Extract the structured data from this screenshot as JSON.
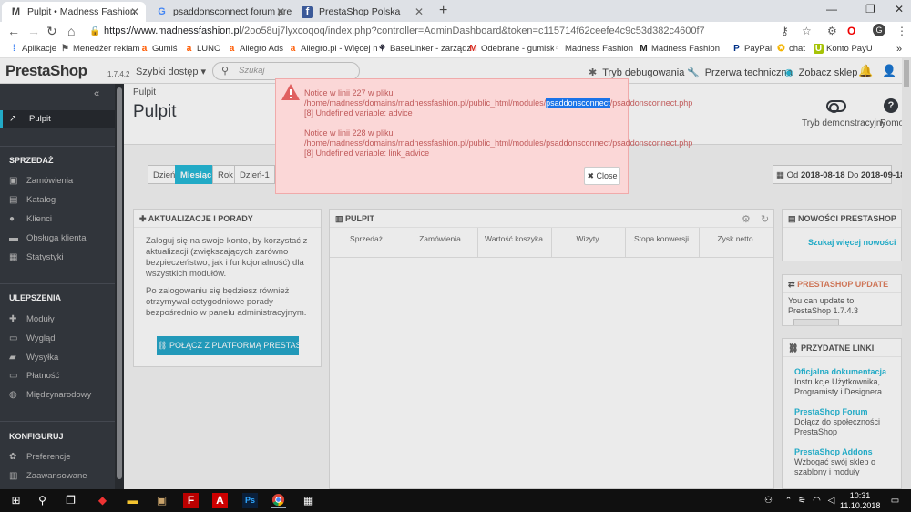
{
  "browser": {
    "tabs": [
      {
        "label": "Pulpit • Madness Fashion",
        "icon": "M"
      },
      {
        "label": "psaddonsconnect forum prestas",
        "icon": "G"
      },
      {
        "label": "PrestaShop Polska",
        "icon": "f"
      }
    ],
    "url_host": "https://www.madnessfashion.pl",
    "url_rest": "/2oo58uj7lyxcoqoq/index.php?controller=AdminDashboard&token=c115714f62ceefe4c9c53d382c4600f7",
    "profile": "G",
    "bookmarks": [
      "Aplikacje",
      "Menedżer reklam",
      "Gumiś",
      "LUNO",
      "Allegro Ads",
      "Allegro.pl - Więcej n",
      "BaseLinker - zarządz",
      "Odebrane - gumiskle",
      "Madness Fashion",
      "Madness Fashion (Pr",
      "PayPal",
      "chat",
      "Konto PayU"
    ]
  },
  "header": {
    "logo": "PrestaShop",
    "version": "1.7.4.2",
    "quick": "Szybki dostęp ▾",
    "search_placeholder": "Szukaj",
    "debug": "Tryb debugowania",
    "maintenance": "Przerwa techniczna",
    "view_shop": "Zobacz sklep"
  },
  "sidebar": {
    "active": "Pulpit",
    "sections": [
      "SPRZEDAŻ",
      "ULEPSZENIA",
      "KONFIGURUJ"
    ],
    "sales": [
      "Zamówienia",
      "Katalog",
      "Klienci",
      "Obsługa klienta",
      "Statystyki"
    ],
    "improve": [
      "Moduły",
      "Wygląd",
      "Wysyłka",
      "Płatność",
      "Międzynarodowy"
    ],
    "config": [
      "Preferencje",
      "Zaawansowane"
    ]
  },
  "page": {
    "breadcrumb": "Pulpit",
    "title": "Pulpit",
    "demo": "Tryb demonstracyjny",
    "help": "Pomoc"
  },
  "datebar": {
    "buttons": [
      "Dzień",
      "Miesiąc",
      "Rok",
      "Dzień-1"
    ],
    "active": "Miesiąc",
    "range_from": "2018-08-18",
    "range_to": "2018-09-18",
    "prefix": "Od",
    "mid": "Do"
  },
  "panels": {
    "updates": {
      "title": "AKTUALIZACJE I PORADY",
      "text1": "Zaloguj się na swoje konto, by korzystać z aktualizacji (zwiększających zarówno bezpieczeństwo, jak i funkcjonalność) dla wszystkich modułów.",
      "text2": "Po zalogowaniu się będziesz również otrzymywał cotygodniowe porady bezpośrednio w panelu administracyjnym.",
      "button": "POŁĄCZ Z PLATFORMĄ PRESTASHOP"
    },
    "dashboard": {
      "title": "PULPIT",
      "kpis": [
        "Sprzedaż",
        "Zamówienia",
        "Wartość koszyka",
        "Wizyty",
        "Stopa konwersji",
        "Zysk netto"
      ]
    },
    "news": {
      "title": "NOWOŚCI PRESTASHOP",
      "link": "Szukaj więcej nowości"
    },
    "psupdate": {
      "title": "PRESTASHOP UPDATE",
      "text": "You can update to PrestaShop 1.7.4.3"
    },
    "links": {
      "title": "PRZYDATNE LINKI",
      "items": [
        {
          "title": "Oficjalna dokumentacja",
          "desc": "Instrukcje Użytkownika, Programisty i Designera"
        },
        {
          "title": "PrestaShop Forum",
          "desc": "Dołącz do społeczności PrestaShop"
        },
        {
          "title": "PrestaShop Addons",
          "desc": "Wzbogać swój sklep o szablony i moduły"
        }
      ]
    }
  },
  "modal": {
    "n1_title": "Notice w linii 227 w pliku",
    "n1_path_a": "/home/madness/domains/madnessfashion.pl/public_html/modules/",
    "n1_path_hl": "psaddonsconnect",
    "n1_path_b": "/psaddonsconnect.php",
    "n1_msg": "[8] Undefined variable: advice",
    "n2_title": "Notice w linii 228 w pliku",
    "n2_path": "/home/madness/domains/madnessfashion.pl/public_html/modules/psaddonsconnect/psaddonsconnect.php",
    "n2_msg": "[8] Undefined variable: link_advice",
    "close": "Close"
  },
  "taskbar": {
    "time": "10:31",
    "date": "11.10.2018"
  }
}
